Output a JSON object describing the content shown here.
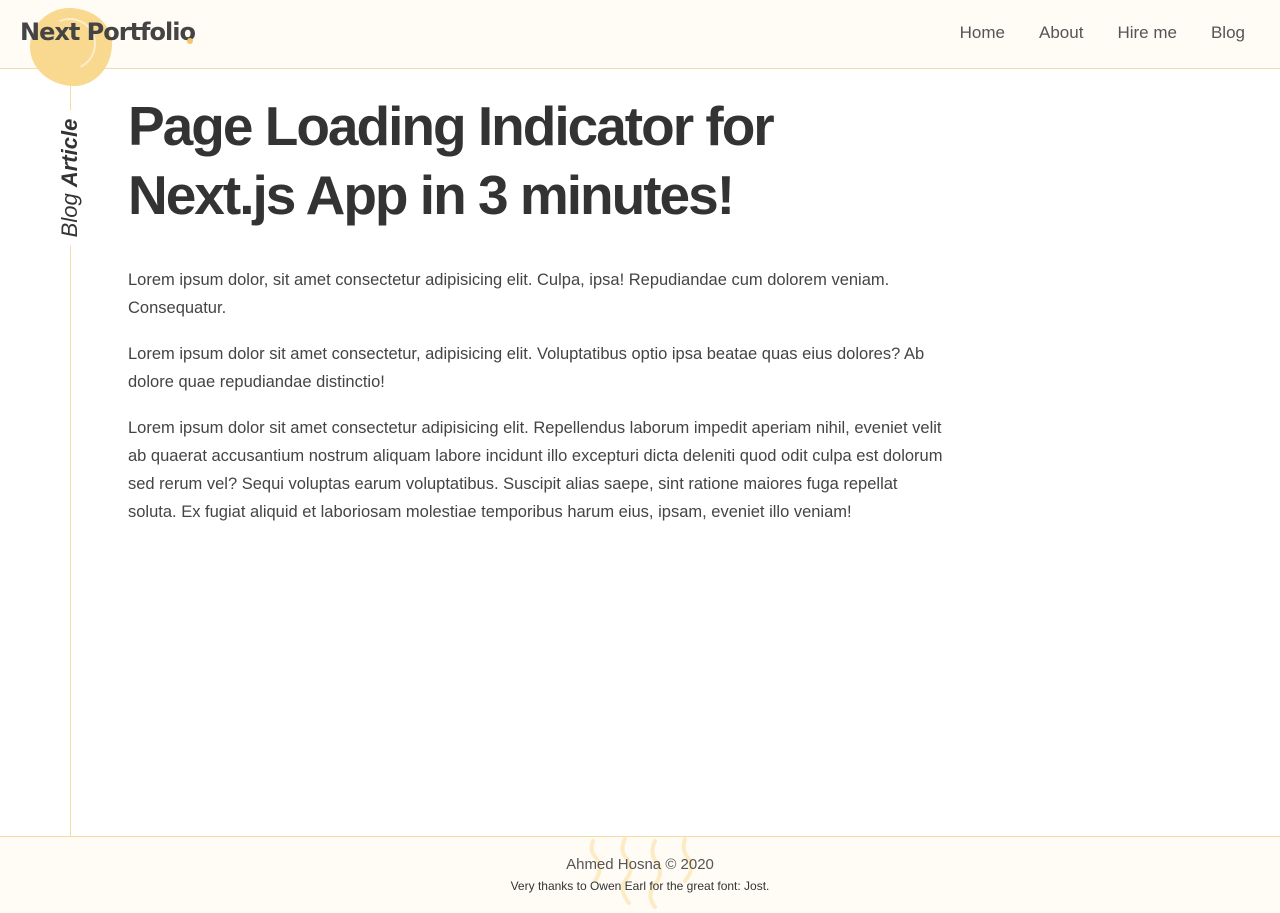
{
  "header": {
    "logo_text": "Next Portfolio",
    "nav": [
      {
        "label": "Home"
      },
      {
        "label": "About"
      },
      {
        "label": "Hire me"
      },
      {
        "label": "Blog"
      }
    ]
  },
  "side_label": {
    "light": "Blog",
    "bold": "Article"
  },
  "article": {
    "title": "Page Loading Indicator for Next.js App in 3 minutes!",
    "paragraphs": [
      "Lorem ipsum dolor, sit amet consectetur adipisicing elit. Culpa, ipsa! Repudiandae cum dolorem veniam. Consequatur.",
      "Lorem ipsum dolor sit amet consectetur, adipisicing elit. Voluptatibus optio ipsa beatae quas eius dolores? Ab dolore quae repudiandae distinctio!",
      "Lorem ipsum dolor sit amet consectetur adipisicing elit. Repellendus laborum impedit aperiam nihil, eveniet velit ab quaerat accusantium nostrum aliquam labore incidunt illo excepturi dicta deleniti quod odit culpa est dolorum sed rerum vel? Sequi voluptas earum voluptatibus. Suscipit alias saepe, sint ratione maiores fuga repellat soluta. Ex fugiat aliquid et laboriosam molestiae temporibus harum eius, ipsam, eveniet illo veniam!"
    ]
  },
  "footer": {
    "author": "Ahmed Hosna © 2020",
    "thanks": "Very thanks to Owen Earl for the great font: Jost."
  },
  "colors": {
    "accent": "#f9d88f",
    "border": "#f3dca6",
    "header_bg": "#fffcf6",
    "text": "#333333"
  }
}
